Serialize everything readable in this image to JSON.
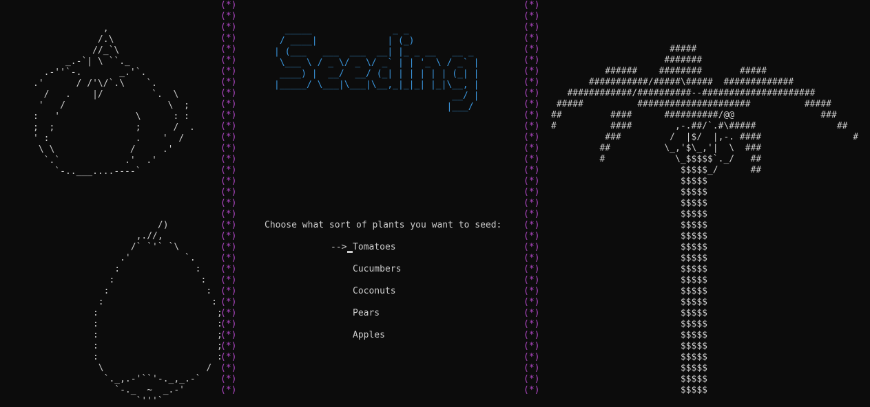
{
  "art": {
    "tomato": "             ,\n            /.\\\n           //_`\\\n      _.-`| \\ ``._\n  .-''`-.       _.'`.\n.'      / /'\\/`.\\    `.\n  /   .    |/         `.  \\\n '   /                   \\  ;\n:   '              \\      : :\n;  ;               ;      /  .\n' :                .    '  /\n \\ \\              /     .'\n  `.`            .'  .'\n    `-..___....----`",
    "pear": "                  /)\n              ,.//,\n             /` `'` `\\\n           .'          `.\n          :              :\n         :                :\n        :                  :\n       :                    :\n      :                      ;\n      :                      :\n      :                      ;\n      :                      ;\n      :                      :\n       \\                   /\n        `._,.-'``'-._,_.-`\n          `-._  ~  _.-'\n              `'''`",
    "palm_tree": "                      #####\n                     #######\n          ######    ########       #####\n       ###########/#####\\#####  #############\n   ############/##########--#####################\n #####          #####################          #####\n##         ####      ##########/@@                ###\n#          ####        ,-.##/`.#\\#####               ##\n          ###         /  |$/  |,-. ####                 #\n         ##          \\_,'$\\_,'|  \\  ###\n         #             \\_$$$$$`._/   ##\n                        $$$$$_/      ##\n                        $$$$$\n                        $$$$$\n                        $$$$$\n                        $$$$$\n                        $$$$$\n                        $$$$$\n                        $$$$$\n                        $$$$$\n                        $$$$$\n                        $$$$$\n                        $$$$$\n                        $$$$$\n                        $$$$$\n                        $$$$$\n                        $$$$$\n                        $$$$$\n                        $$$$$\n                        $$$$$\n                        $$$$$\n                        $$$$$",
    "title_banner": "  _____               _ _\n / ____|             | (_)\n| (___   ___  ___  __| |_ _ __   __ _\n \\___ \\ / _ \\/ _ \\/ _` | | '_ \\ / _` |\n ____) |  __/  __/ (_| | | | | | (_| |\n|_____/ \\___|\\___|\\__,_|_|_| |_|\\__, |\n                                 __/ |\n                                |___/",
    "divider": "(*)\n(*)\n(*)\n(*)\n(*)\n(*)\n(*)\n(*)\n(*)\n(*)\n(*)\n(*)\n(*)\n(*)\n(*)\n(*)\n(*)\n(*)\n(*)\n(*)\n(*)\n(*)\n(*)\n(*)\n(*)\n(*)\n(*)\n(*)\n(*)\n(*)\n(*)\n(*)\n(*)\n(*)\n(*)\n(*)"
  },
  "menu": {
    "prompt": "Choose what sort of plants you want to seed:",
    "arrow": "-->",
    "options": [
      "Tomatoes",
      "Cucumbers",
      "Coconuts",
      "Pears",
      "Apples"
    ],
    "selected_index": 0
  },
  "colors": {
    "background": "#0c0c0c",
    "text": "#cccccc",
    "divider": "#b148c6",
    "title": "#3a96dd"
  }
}
